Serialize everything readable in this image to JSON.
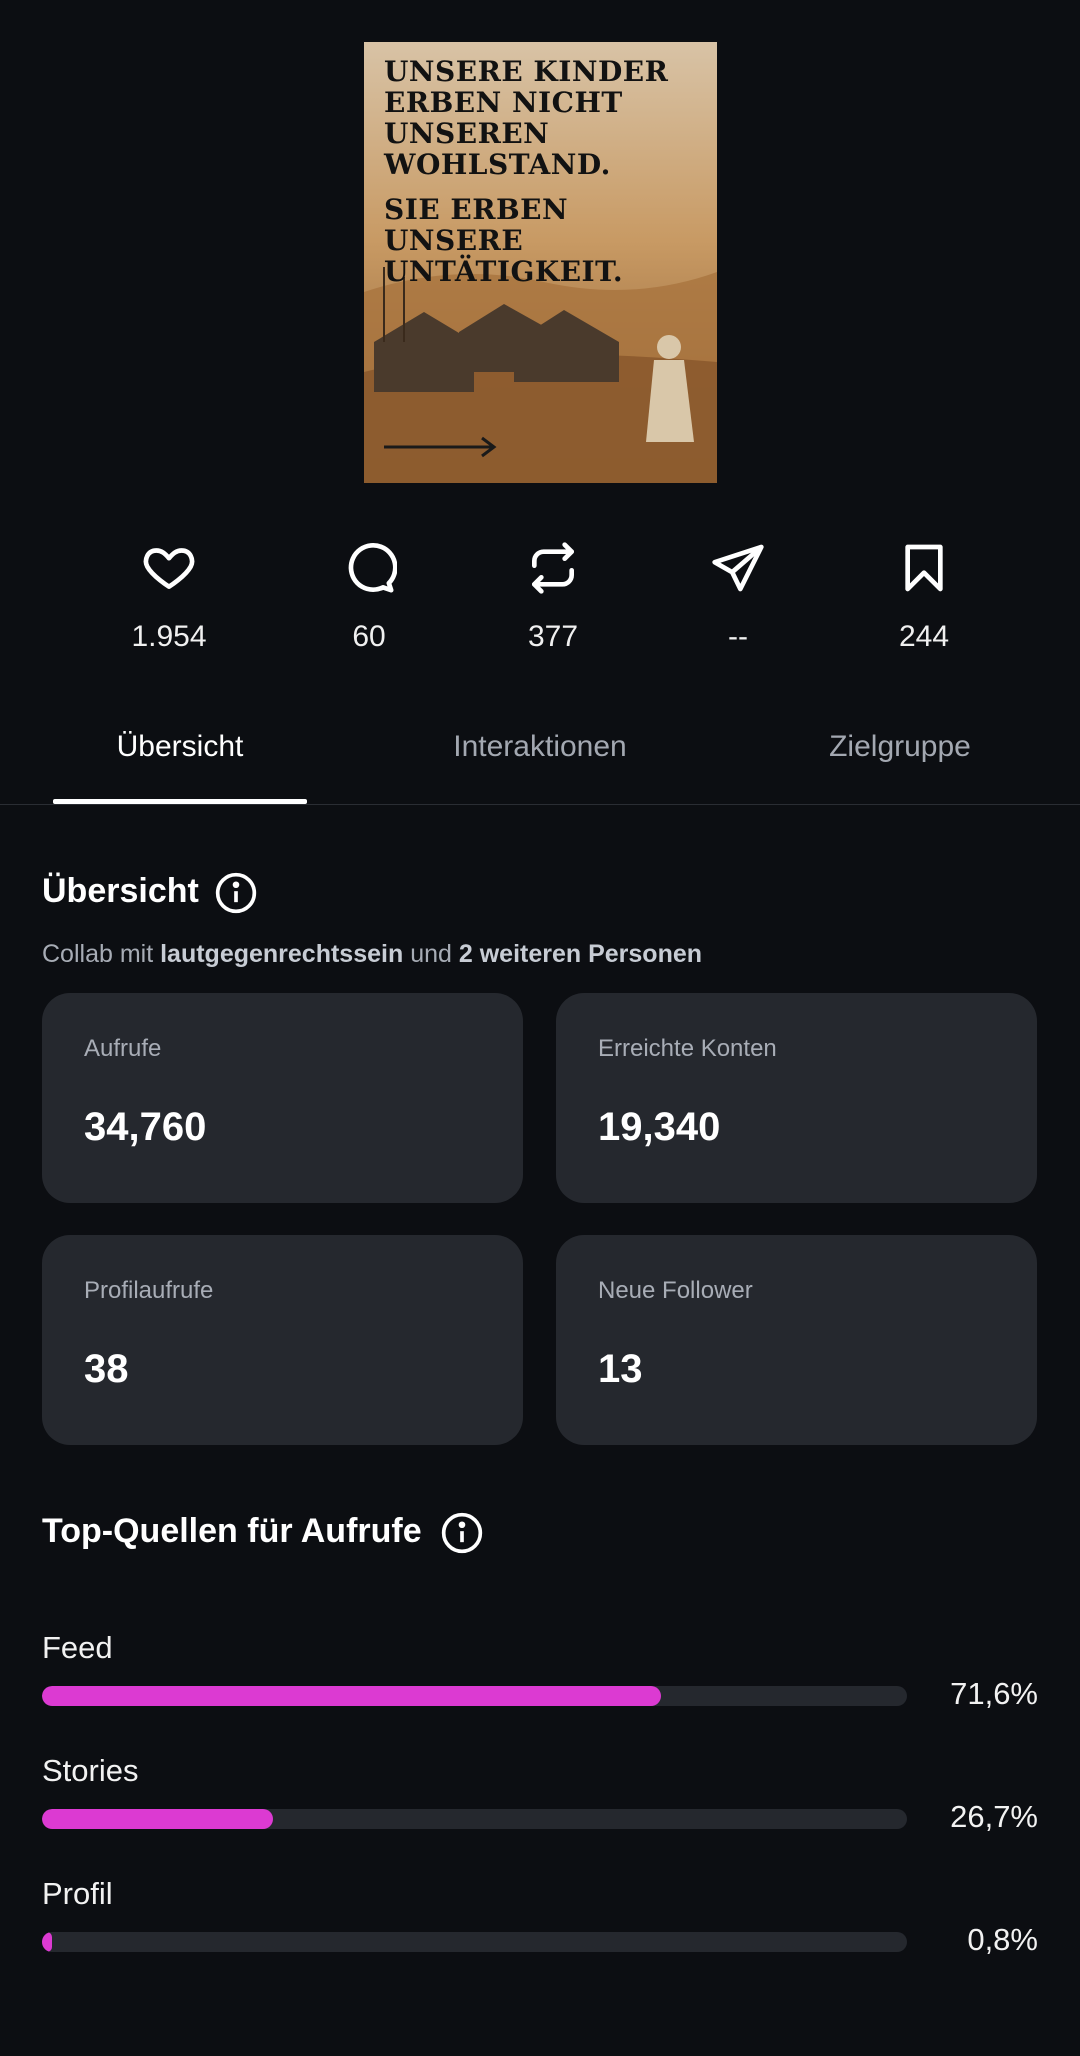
{
  "post": {
    "poster_line1": "UNSERE KINDER ERBEN NICHT UNSEREN WOHLSTAND.",
    "poster_line2": "SIE ERBEN UNSERE UNTÄTIGKEIT."
  },
  "stats": {
    "likes": "1.954",
    "comments": "60",
    "reposts": "377",
    "shares": "--",
    "saves": "244"
  },
  "tabs": [
    {
      "label": "Übersicht",
      "active": true
    },
    {
      "label": "Interaktionen",
      "active": false
    },
    {
      "label": "Zielgruppe",
      "active": false
    }
  ],
  "overview": {
    "title": "Übersicht",
    "collab_prefix": "Collab mit",
    "collab_user": "lautgegenrechtssein",
    "collab_and": "und",
    "collab_others": "2 weiteren Personen",
    "cards": [
      {
        "label": "Aufrufe",
        "value": "34,760"
      },
      {
        "label": "Erreichte Konten",
        "value": "19,340"
      },
      {
        "label": "Profilaufrufe",
        "value": "38"
      },
      {
        "label": "Neue Follower",
        "value": "13"
      }
    ]
  },
  "sources": {
    "title": "Top-Quellen für Aufrufe",
    "accent_color": "#dc3ad2",
    "items": [
      {
        "name": "Feed",
        "percent_label": "71,6%",
        "fraction": 0.716
      },
      {
        "name": "Stories",
        "percent_label": "26,7%",
        "fraction": 0.267
      },
      {
        "name": "Profil",
        "percent_label": "0,8%",
        "fraction": 0.008
      }
    ]
  }
}
